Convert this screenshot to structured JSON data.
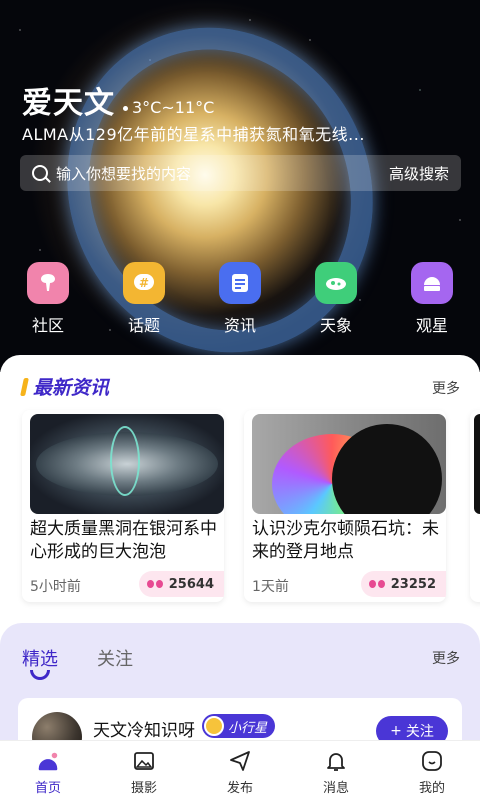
{
  "hero": {
    "title": "爱天文",
    "temperature": "3°C~11°C",
    "headline": "ALMA从129亿年前的星系中捕获氮和氧无线...",
    "search_placeholder": "输入你想要找的内容",
    "advanced_search": "高级搜索"
  },
  "quick_links": [
    {
      "label": "社区",
      "icon": "tree-icon",
      "color": "#f184ac"
    },
    {
      "label": "话题",
      "icon": "hashtag-icon",
      "color": "#f3b632"
    },
    {
      "label": "资讯",
      "icon": "news-icon",
      "color": "#4a6ef0"
    },
    {
      "label": "天象",
      "icon": "sky-icon",
      "color": "#3fce7a"
    },
    {
      "label": "观星",
      "icon": "observatory-icon",
      "color": "#a566f0"
    }
  ],
  "news": {
    "title": "最新资讯",
    "more": "更多",
    "cards": [
      {
        "title": "超大质量黑洞在银河系中心形成的巨大泡泡",
        "time": "5小时前",
        "views": "25644"
      },
      {
        "title": "认识沙克尔顿陨石坑：未来的登月地点",
        "time": "1天前",
        "views": "23252"
      }
    ]
  },
  "feed": {
    "tabs": [
      "精选",
      "关注"
    ],
    "more": "更多",
    "post": {
      "name": "天文冷知识呀",
      "badge": "小行星",
      "follow": "关注"
    }
  },
  "tabbar": [
    {
      "label": "首页",
      "icon": "home-icon",
      "active": true
    },
    {
      "label": "摄影",
      "icon": "photo-icon",
      "active": false
    },
    {
      "label": "发布",
      "icon": "send-icon",
      "active": false
    },
    {
      "label": "消息",
      "icon": "bell-icon",
      "active": false
    },
    {
      "label": "我的",
      "icon": "profile-icon",
      "active": false
    }
  ],
  "colors": {
    "accent": "#3f28c8",
    "highlight": "#f6b31b"
  }
}
